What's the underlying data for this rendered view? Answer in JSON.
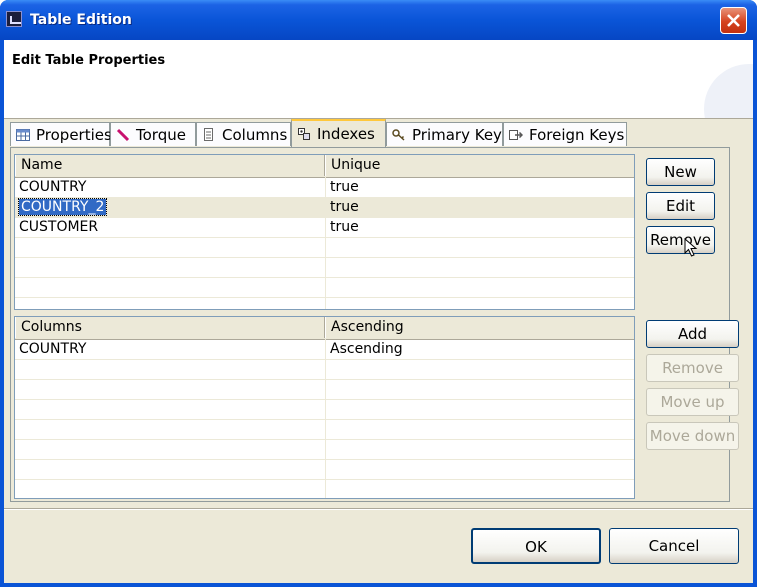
{
  "window": {
    "title": "Table Edition"
  },
  "header": {
    "title": "Edit Table Properties"
  },
  "tabs": [
    {
      "label": "Properties",
      "icon": "table-icon"
    },
    {
      "label": "Torque",
      "icon": "pencil-icon"
    },
    {
      "label": "Columns",
      "icon": "columns-icon"
    },
    {
      "label": "Indexes",
      "icon": "indexes-icon",
      "active": true
    },
    {
      "label": "Primary Key",
      "icon": "key-icon"
    },
    {
      "label": "Foreign Keys",
      "icon": "foreign-key-icon"
    }
  ],
  "indexes_table": {
    "headers": [
      "Name",
      "Unique"
    ],
    "rows": [
      [
        "COUNTRY",
        "true"
      ],
      [
        "COUNTRY_2",
        "true"
      ],
      [
        "CUSTOMER",
        "true"
      ]
    ],
    "selected_row": 1
  },
  "index_buttons": {
    "new": "New",
    "edit": "Edit",
    "remove": "Remove"
  },
  "columns_table": {
    "headers": [
      "Columns",
      "Ascending"
    ],
    "rows": [
      [
        "COUNTRY",
        "Ascending"
      ]
    ]
  },
  "column_buttons": {
    "add": "Add",
    "remove": "Remove",
    "move_up": "Move up",
    "move_down": "Move down"
  },
  "footer": {
    "ok": "OK",
    "cancel": "Cancel"
  },
  "colors": {
    "title_bar": "#0a55d8",
    "selection": "#316ac5",
    "dialog_bg": "#ece9d8",
    "close_button": "#d5431f"
  }
}
